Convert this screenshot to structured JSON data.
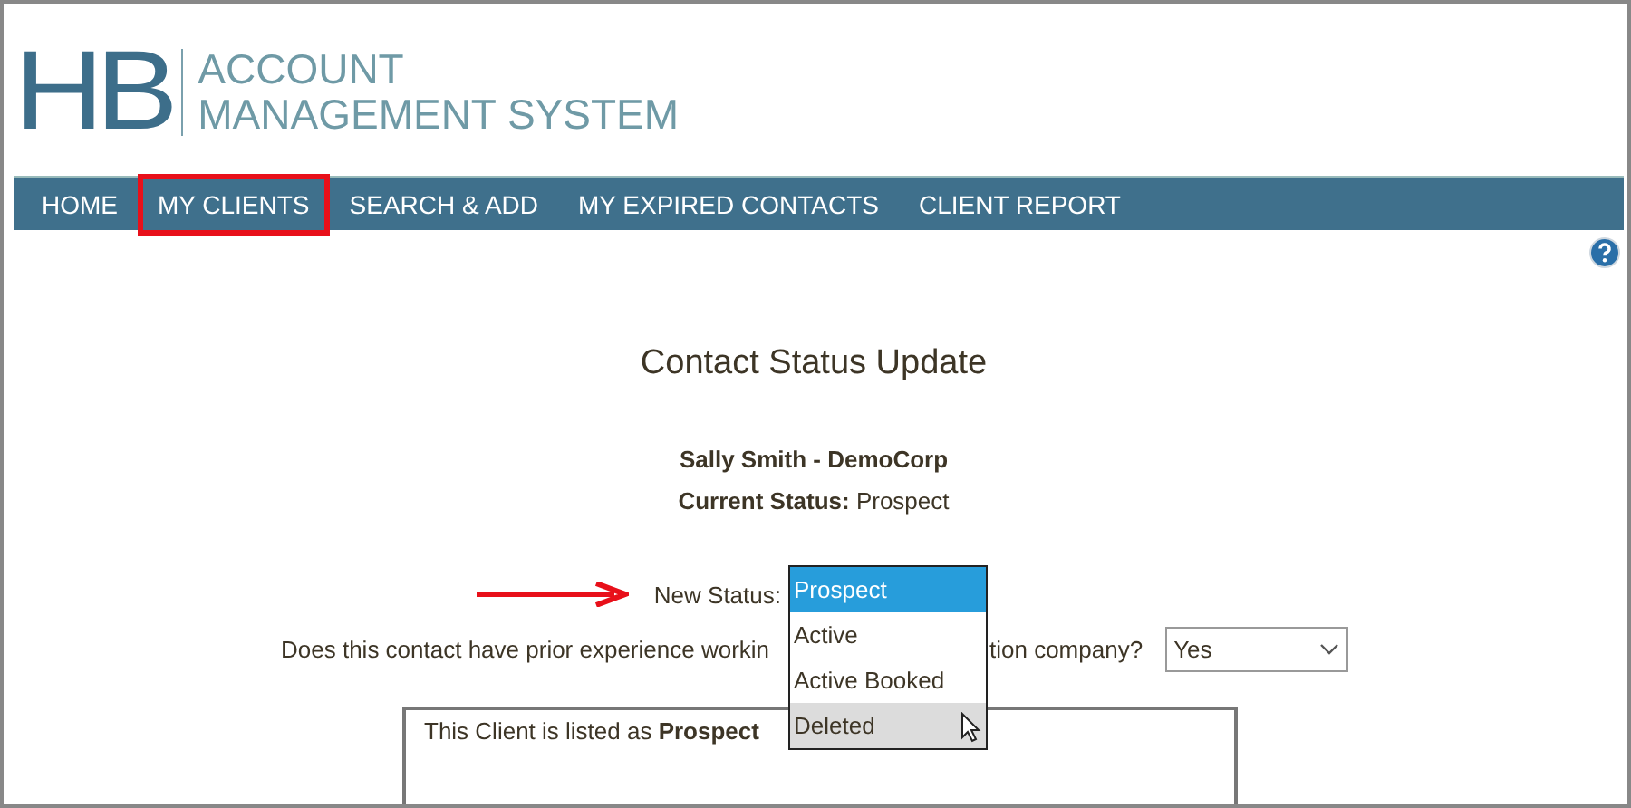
{
  "logo": {
    "mark": "HB",
    "line_1": "ACCOUNT",
    "line_2": "MANAGEMENT SYSTEM"
  },
  "nav": [
    {
      "label": "HOME",
      "highlighted": false
    },
    {
      "label": "MY CLIENTS",
      "highlighted": true
    },
    {
      "label": "SEARCH & ADD",
      "highlighted": false
    },
    {
      "label": "MY EXPIRED CONTACTS",
      "highlighted": false
    },
    {
      "label": "CLIENT REPORT",
      "highlighted": false
    }
  ],
  "title": "Contact Status Update",
  "contact": "Sally Smith - DemoCorp",
  "current_status": {
    "label": "Current Status:",
    "value": "Prospect"
  },
  "new_status": {
    "label": "New Status:",
    "options": [
      {
        "label": "Prospect",
        "selected": true,
        "hovered": false
      },
      {
        "label": "Active",
        "selected": false,
        "hovered": false
      },
      {
        "label": "Active Booked",
        "selected": false,
        "hovered": false
      },
      {
        "label": "Deleted",
        "selected": false,
        "hovered": true
      }
    ]
  },
  "question": {
    "text_before": "Does this contact have prior experience workin",
    "text_after": "tion company?",
    "value": "Yes"
  },
  "note": "This Client is listed as **Prospect**"
}
